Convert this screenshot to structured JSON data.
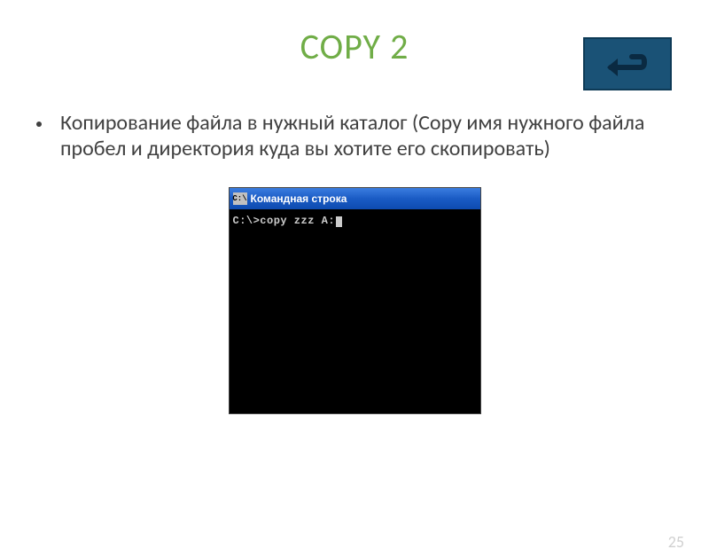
{
  "title": "COPY 2",
  "body_text": "Копирование файла в нужный каталог (Copy имя нужного файла пробел и директория куда вы хотите его скопировать)",
  "cmd": {
    "icon_text": "C:\\",
    "title": "Командная строка",
    "line": "C:\\>copy zzz A:"
  },
  "page_number": "25"
}
